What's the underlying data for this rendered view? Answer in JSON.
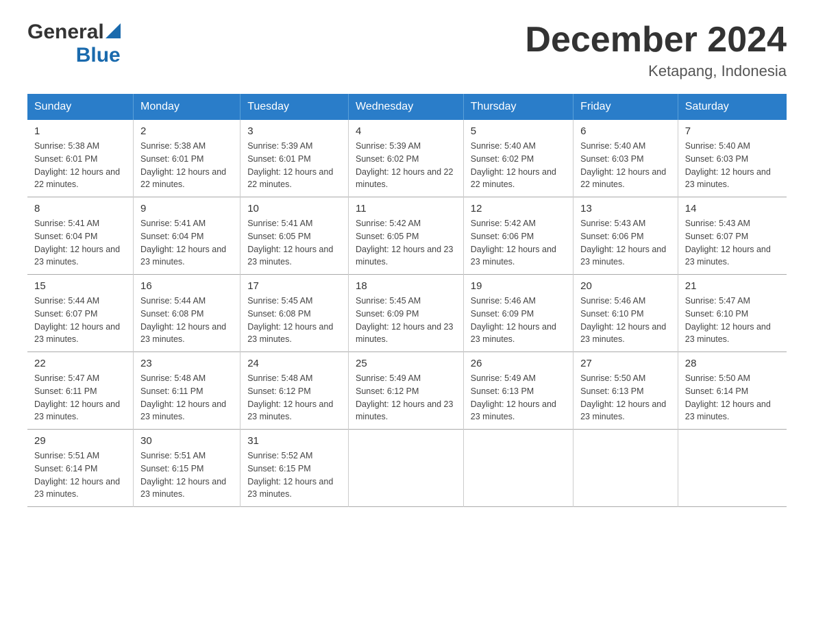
{
  "header": {
    "logo_general": "General",
    "logo_blue": "Blue",
    "title": "December 2024",
    "subtitle": "Ketapang, Indonesia"
  },
  "calendar": {
    "days_of_week": [
      "Sunday",
      "Monday",
      "Tuesday",
      "Wednesday",
      "Thursday",
      "Friday",
      "Saturday"
    ],
    "weeks": [
      [
        {
          "date": "1",
          "sunrise": "5:38 AM",
          "sunset": "6:01 PM",
          "daylight": "12 hours and 22 minutes."
        },
        {
          "date": "2",
          "sunrise": "5:38 AM",
          "sunset": "6:01 PM",
          "daylight": "12 hours and 22 minutes."
        },
        {
          "date": "3",
          "sunrise": "5:39 AM",
          "sunset": "6:01 PM",
          "daylight": "12 hours and 22 minutes."
        },
        {
          "date": "4",
          "sunrise": "5:39 AM",
          "sunset": "6:02 PM",
          "daylight": "12 hours and 22 minutes."
        },
        {
          "date": "5",
          "sunrise": "5:40 AM",
          "sunset": "6:02 PM",
          "daylight": "12 hours and 22 minutes."
        },
        {
          "date": "6",
          "sunrise": "5:40 AM",
          "sunset": "6:03 PM",
          "daylight": "12 hours and 22 minutes."
        },
        {
          "date": "7",
          "sunrise": "5:40 AM",
          "sunset": "6:03 PM",
          "daylight": "12 hours and 23 minutes."
        }
      ],
      [
        {
          "date": "8",
          "sunrise": "5:41 AM",
          "sunset": "6:04 PM",
          "daylight": "12 hours and 23 minutes."
        },
        {
          "date": "9",
          "sunrise": "5:41 AM",
          "sunset": "6:04 PM",
          "daylight": "12 hours and 23 minutes."
        },
        {
          "date": "10",
          "sunrise": "5:41 AM",
          "sunset": "6:05 PM",
          "daylight": "12 hours and 23 minutes."
        },
        {
          "date": "11",
          "sunrise": "5:42 AM",
          "sunset": "6:05 PM",
          "daylight": "12 hours and 23 minutes."
        },
        {
          "date": "12",
          "sunrise": "5:42 AM",
          "sunset": "6:06 PM",
          "daylight": "12 hours and 23 minutes."
        },
        {
          "date": "13",
          "sunrise": "5:43 AM",
          "sunset": "6:06 PM",
          "daylight": "12 hours and 23 minutes."
        },
        {
          "date": "14",
          "sunrise": "5:43 AM",
          "sunset": "6:07 PM",
          "daylight": "12 hours and 23 minutes."
        }
      ],
      [
        {
          "date": "15",
          "sunrise": "5:44 AM",
          "sunset": "6:07 PM",
          "daylight": "12 hours and 23 minutes."
        },
        {
          "date": "16",
          "sunrise": "5:44 AM",
          "sunset": "6:08 PM",
          "daylight": "12 hours and 23 minutes."
        },
        {
          "date": "17",
          "sunrise": "5:45 AM",
          "sunset": "6:08 PM",
          "daylight": "12 hours and 23 minutes."
        },
        {
          "date": "18",
          "sunrise": "5:45 AM",
          "sunset": "6:09 PM",
          "daylight": "12 hours and 23 minutes."
        },
        {
          "date": "19",
          "sunrise": "5:46 AM",
          "sunset": "6:09 PM",
          "daylight": "12 hours and 23 minutes."
        },
        {
          "date": "20",
          "sunrise": "5:46 AM",
          "sunset": "6:10 PM",
          "daylight": "12 hours and 23 minutes."
        },
        {
          "date": "21",
          "sunrise": "5:47 AM",
          "sunset": "6:10 PM",
          "daylight": "12 hours and 23 minutes."
        }
      ],
      [
        {
          "date": "22",
          "sunrise": "5:47 AM",
          "sunset": "6:11 PM",
          "daylight": "12 hours and 23 minutes."
        },
        {
          "date": "23",
          "sunrise": "5:48 AM",
          "sunset": "6:11 PM",
          "daylight": "12 hours and 23 minutes."
        },
        {
          "date": "24",
          "sunrise": "5:48 AM",
          "sunset": "6:12 PM",
          "daylight": "12 hours and 23 minutes."
        },
        {
          "date": "25",
          "sunrise": "5:49 AM",
          "sunset": "6:12 PM",
          "daylight": "12 hours and 23 minutes."
        },
        {
          "date": "26",
          "sunrise": "5:49 AM",
          "sunset": "6:13 PM",
          "daylight": "12 hours and 23 minutes."
        },
        {
          "date": "27",
          "sunrise": "5:50 AM",
          "sunset": "6:13 PM",
          "daylight": "12 hours and 23 minutes."
        },
        {
          "date": "28",
          "sunrise": "5:50 AM",
          "sunset": "6:14 PM",
          "daylight": "12 hours and 23 minutes."
        }
      ],
      [
        {
          "date": "29",
          "sunrise": "5:51 AM",
          "sunset": "6:14 PM",
          "daylight": "12 hours and 23 minutes."
        },
        {
          "date": "30",
          "sunrise": "5:51 AM",
          "sunset": "6:15 PM",
          "daylight": "12 hours and 23 minutes."
        },
        {
          "date": "31",
          "sunrise": "5:52 AM",
          "sunset": "6:15 PM",
          "daylight": "12 hours and 23 minutes."
        },
        {
          "date": "",
          "sunrise": "",
          "sunset": "",
          "daylight": ""
        },
        {
          "date": "",
          "sunrise": "",
          "sunset": "",
          "daylight": ""
        },
        {
          "date": "",
          "sunrise": "",
          "sunset": "",
          "daylight": ""
        },
        {
          "date": "",
          "sunrise": "",
          "sunset": "",
          "daylight": ""
        }
      ]
    ]
  }
}
